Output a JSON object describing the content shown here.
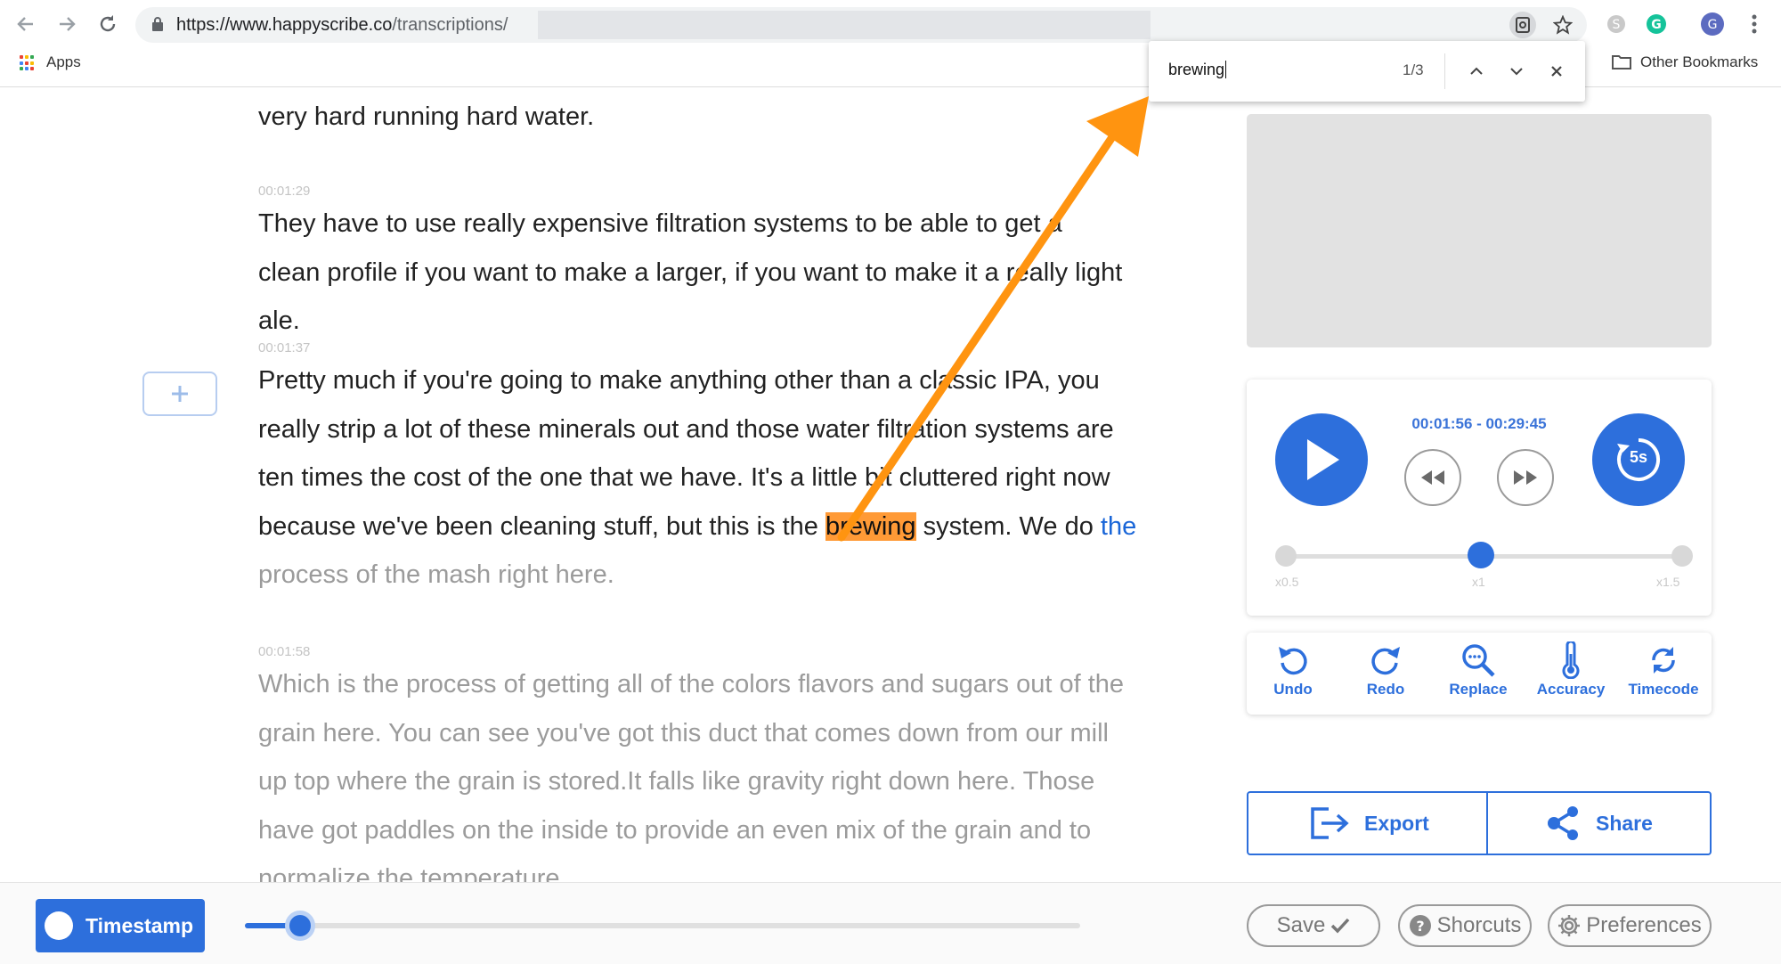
{
  "browser": {
    "url_domain": "https://www.happyscribe.co",
    "url_path": "/transcriptions/",
    "bookmarks": {
      "apps_label": "Apps",
      "other_label": "Other Bookmarks"
    }
  },
  "find_bar": {
    "query": "brewing",
    "match_count": "1/3"
  },
  "transcript": {
    "intro_line": "very hard running hard water.",
    "paragraphs": [
      {
        "timestamp": "00:01:29",
        "text": "They have to use really expensive filtration systems to be able to get a clean profile if you want to make a larger, if you want to make it a really light ale."
      },
      {
        "timestamp": "00:01:37",
        "text_before": "Pretty much if you're going to make anything other than a classic IPA, you really strip a lot of these minerals out and those water filtration systems are ten times the cost of the one that we have. It's a little bit cluttered right now because we've been cleaning stuff, but this is the ",
        "highlight": "brewing",
        "text_after": " system. We do ",
        "current_word": "the",
        "text_rest": "process of the mash right here."
      },
      {
        "timestamp": "00:01:58",
        "text": "Which is the process of getting all of the colors flavors and sugars out of the grain here. You can see you've got this duct that comes down from our mill up top where the grain is stored.It falls like gravity right down here. Those have got paddles on the inside to provide an even mix of the grain and to normalize the temperature."
      }
    ]
  },
  "player": {
    "time_range": "00:01:56 - 00:29:45",
    "skip_label": "5s",
    "speed_labels": [
      "x0.5",
      "x1",
      "x1.5"
    ],
    "speed_value": 1.0
  },
  "tools": [
    {
      "label": "Undo",
      "icon": "undo-icon"
    },
    {
      "label": "Redo",
      "icon": "redo-icon"
    },
    {
      "label": "Replace",
      "icon": "search-icon"
    },
    {
      "label": "Accuracy",
      "icon": "thermometer-icon"
    },
    {
      "label": "Timecode",
      "icon": "sync-icon"
    }
  ],
  "actions": {
    "export_label": "Export",
    "share_label": "Share"
  },
  "bottom_bar": {
    "timestamp_label": "Timestamp",
    "progress_fraction": 0.066,
    "save_label": "Save",
    "shortcuts_label": "Shorcuts",
    "preferences_label": "Preferences"
  },
  "colors": {
    "accent_blue": "#2d6fdc",
    "highlight_orange": "#ff9a36",
    "annotation_arrow": "#ff9410"
  }
}
